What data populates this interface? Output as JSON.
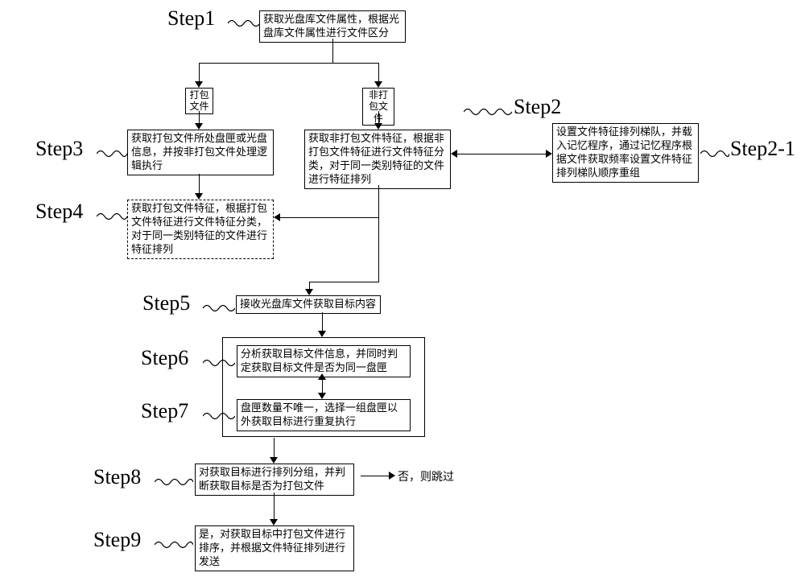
{
  "labels": {
    "step1": "Step1",
    "step2": "Step2",
    "step2_1": "Step2-1",
    "step3": "Step3",
    "step4": "Step4",
    "step5": "Step5",
    "step6": "Step6",
    "step7": "Step7",
    "step8": "Step8",
    "step9": "Step9"
  },
  "nodes": {
    "s1": "获取光盘库文件属性，根据光盘库文件属性进行文件区分",
    "branch_pack": "打包文件",
    "branch_nonpack": "非打包文件",
    "s2": "获取非打包文件特征，根据非打包文件特征进行文件特征分类，对于同一类别特征的文件进行特征排列",
    "s2_1": "设置文件特征排列梯队，并载入记忆程序，通过记忆程序根据文件获取频率设置文件特征排列梯队顺序重组",
    "s3": "获取打包文件所处盘匣或光盘信息，并按非打包文件处理逻辑执行",
    "s4": "获取打包文件特征，根据打包文件特征进行文件特征分类，对于同一类别特征的文件进行特征排列",
    "s5": "接收光盘库文件获取目标内容",
    "s6": "分析获取目标文件信息，并同时判定获取目标文件是否为同一盘匣",
    "s7": "盘匣数量不唯一，选择一组盘匣以外获取目标进行重复执行",
    "s8": "对获取目标进行排列分组，并判断获取目标是否为打包文件",
    "s9": "是，对获取目标中打包文件进行排序，并根据文件特征排列进行发送",
    "skip": "否，则跳过"
  }
}
